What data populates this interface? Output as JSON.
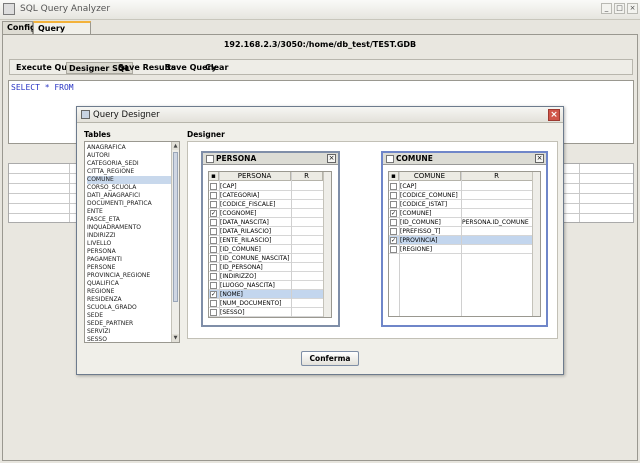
{
  "window": {
    "title": "SQL Query Analyzer"
  },
  "tabs": [
    {
      "label": "Config"
    },
    {
      "label": "Query Analyzer"
    }
  ],
  "connection": "192.168.2.3/3050:/home/db_test/TEST.GDB",
  "toolbar": {
    "execute": "Execute Query",
    "designer": "Designer SQL",
    "save_results": "Save Results",
    "save_query": "Save Query",
    "clear": "Clear"
  },
  "sql_text": "SELECT * FROM",
  "dialog": {
    "title": "Query Designer",
    "tables_label": "Tables",
    "designer_label": "Designer",
    "confirm": "Conferma",
    "close": "×",
    "table_items": [
      "ANAGRAFICA",
      "AUTORI",
      "CATEGORIA_SEDI",
      "CITTA_REGIONE",
      "COMUNE",
      "CORSO_SCUOLA",
      "DATI_ANAGRAFICI",
      "DOCUMENTI_PRATICA",
      "ENTE",
      "FASCE_ETA",
      "INQUADRAMENTO",
      "INDIRIZZI",
      "LIVELLO",
      "PERSONA",
      "PAGAMENTI",
      "PERSONE",
      "PROVINCIA_REGIONE",
      "QUALIFICA",
      "REGIONE",
      "RESIDENZA",
      "SCUOLA_GRADO",
      "SEDE",
      "SEDE_PARTNER",
      "SERVIZI",
      "SESSO"
    ],
    "persona": {
      "name": "PERSONA",
      "col_name": "PERSONA",
      "col_r": "R",
      "rows": [
        {
          "label": "[CAP]",
          "r": "",
          "checked": false
        },
        {
          "label": "[CATEGORIA]",
          "r": "",
          "checked": false
        },
        {
          "label": "[CODICE_FISCALE]",
          "r": "",
          "checked": false
        },
        {
          "label": "[COGNOME]",
          "r": "",
          "checked": true
        },
        {
          "label": "[DATA_NASCITA]",
          "r": "",
          "checked": false
        },
        {
          "label": "[DATA_RILASCIO]",
          "r": "",
          "checked": false
        },
        {
          "label": "[ENTE_RILASCIO]",
          "r": "",
          "checked": false
        },
        {
          "label": "[ID_COMUNE]",
          "r": "",
          "checked": false
        },
        {
          "label": "[ID_COMUNE_NASCITA]",
          "r": "",
          "checked": false
        },
        {
          "label": "[ID_PERSONA]",
          "r": "",
          "checked": false
        },
        {
          "label": "[INDIRIZZO]",
          "r": "",
          "checked": false
        },
        {
          "label": "[LUOGO_NASCITA]",
          "r": "",
          "checked": false
        },
        {
          "label": "[NOME]",
          "r": "",
          "checked": true
        },
        {
          "label": "[NUM_DOCUMENTO]",
          "r": "",
          "checked": false
        },
        {
          "label": "[SESSO]",
          "r": "",
          "checked": false
        }
      ]
    },
    "comune": {
      "name": "COMUNE",
      "col_name": "COMUNE",
      "col_r": "R",
      "rows": [
        {
          "label": "[CAP]",
          "r": "",
          "checked": false
        },
        {
          "label": "[CODICE_COMUNE]",
          "r": "",
          "checked": false
        },
        {
          "label": "[CODICE_ISTAT]",
          "r": "",
          "checked": false
        },
        {
          "label": "[COMUNE]",
          "r": "",
          "checked": true
        },
        {
          "label": "[ID_COMUNE]",
          "r": "PERSONA.ID_COMUNE",
          "checked": false
        },
        {
          "label": "[PREFISSO_T]",
          "r": "",
          "checked": false
        },
        {
          "label": "[PROVINCIA]",
          "r": "",
          "checked": true
        },
        {
          "label": "[REGIONE]",
          "r": "",
          "checked": false
        }
      ]
    }
  }
}
